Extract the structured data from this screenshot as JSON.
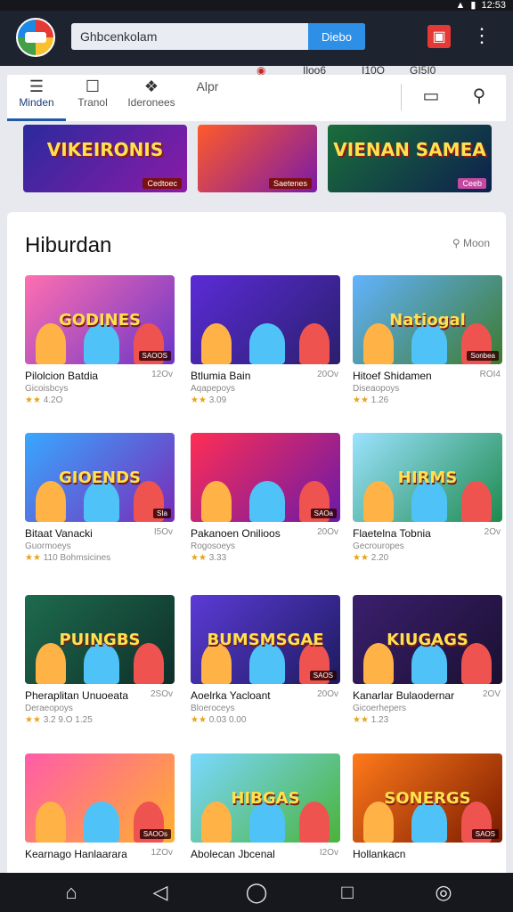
{
  "status_bar": {
    "time": "12:53"
  },
  "header": {
    "search": {
      "value": "Ghbcenkolam",
      "button": "Diebo"
    }
  },
  "sub_labels": [
    "Iloo6",
    "I10O",
    "GI5I0"
  ],
  "tabs": [
    {
      "label": "Minden",
      "icon": "menu-icon"
    },
    {
      "label": "Tranol",
      "icon": "clipboard-icon"
    },
    {
      "label": "Ideronees",
      "icon": "gift-icon"
    },
    {
      "label": "Alpr",
      "icon": ""
    }
  ],
  "banners": [
    {
      "title": "VIKEIRONIS",
      "tag": "Cedtoec"
    },
    {
      "title": "",
      "tag": "Saetenes"
    },
    {
      "title": "VIENAN SAMEA",
      "tag": "Ceeb"
    }
  ],
  "section": {
    "title": "Hiburdan",
    "more": "Moon"
  },
  "games": [
    {
      "name": "Pilolcion Batdia",
      "size": "12Ov",
      "sub": "Gicoisbcys",
      "rating": "4.2O",
      "thumb_text": "GODINES",
      "tag": "SAOOS",
      "colors": [
        "#ff6fb0",
        "#6a35c8"
      ]
    },
    {
      "name": "Btlumia Bain",
      "size": "20Ov",
      "sub": "Aqapepoys",
      "rating": "3.09",
      "thumb_text": "",
      "tag": "",
      "colors": [
        "#5b2bd6",
        "#2a1f6e"
      ]
    },
    {
      "name": "Hitoef Shidamen",
      "size": "ROI4",
      "sub": "Diseaopoys",
      "rating": "1.26",
      "thumb_text": "Natiogal",
      "tag": "Sonbea",
      "colors": [
        "#62b3ff",
        "#3d7a2e"
      ]
    },
    {
      "name": "Bitaat Vanacki",
      "size": "I5Ov",
      "sub": "Guormoeys",
      "rating": "110 Bohmsicines",
      "thumb_text": "GIOENDS",
      "tag": "SIa",
      "colors": [
        "#38a8ff",
        "#7a2ab8"
      ]
    },
    {
      "name": "Pakanoen Onilioos",
      "size": "20Ov",
      "sub": "Rogosoeys",
      "rating": "3.33",
      "thumb_text": "",
      "tag": "SAOa",
      "colors": [
        "#ff2d55",
        "#6a1aa8"
      ]
    },
    {
      "name": "Flaetelna Tobnia",
      "size": "2Ov",
      "sub": "Gecrouropes",
      "rating": "2.20",
      "thumb_text": "HIRMS",
      "tag": "",
      "colors": [
        "#9be3ff",
        "#1e8a4e"
      ]
    },
    {
      "name": "Pheraplitan Unuoeata",
      "size": "2SOv",
      "sub": "Deraeopoys",
      "rating": "3.2 9.O 1.25",
      "thumb_text": "PUINGBS",
      "tag": "",
      "colors": [
        "#1d6b4e",
        "#0f2e28"
      ]
    },
    {
      "name": "Aoelrka Yacloant",
      "size": "20Ov",
      "sub": "Bloeroceys",
      "rating": "0.03 0.00",
      "thumb_text": "BUMSMSGAE",
      "tag": "SAOS",
      "colors": [
        "#5b3bd6",
        "#1d1a5e"
      ]
    },
    {
      "name": "Kanarlar Bulaodernar",
      "size": "2OV",
      "sub": "Gicoerhepers",
      "rating": "1.23",
      "thumb_text": "KIUGAGS",
      "tag": "",
      "colors": [
        "#3b1f6e",
        "#1a1030"
      ]
    },
    {
      "name": "Kearnago Hanlaarara",
      "size": "1ZOv",
      "sub": "",
      "rating": "",
      "thumb_text": "",
      "tag": "SAOOs",
      "colors": [
        "#ff5ca8",
        "#ffb02e"
      ]
    },
    {
      "name": "Abolecan Jbcenal",
      "size": "I2Ov",
      "sub": "",
      "rating": "",
      "thumb_text": "HIBGAS",
      "tag": "",
      "colors": [
        "#7ad8ff",
        "#4bb33a"
      ]
    },
    {
      "name": "Hollankacn",
      "size": "",
      "sub": "",
      "rating": "",
      "thumb_text": "SONERGS",
      "tag": "SAOS",
      "colors": [
        "#ff7a1a",
        "#7a1a00"
      ]
    }
  ]
}
